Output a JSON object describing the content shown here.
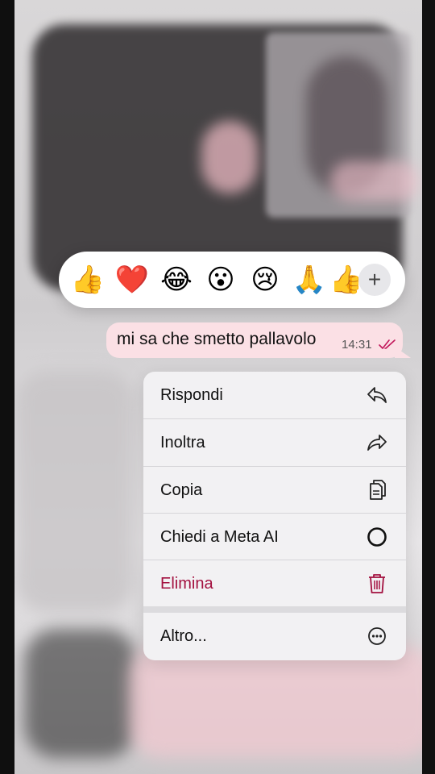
{
  "reactions": {
    "emojis": [
      "👍",
      "❤️",
      "😂",
      "😮",
      "😢",
      "🙏",
      "👍"
    ],
    "more_label": "+"
  },
  "message": {
    "text": "mi sa che smetto pallavolo",
    "time": "14:31",
    "status": "read",
    "bubble_color": "#fbe0e5",
    "tick_color": "#c2185b"
  },
  "menu": {
    "items": [
      {
        "label": "Rispondi",
        "icon": "reply-icon"
      },
      {
        "label": "Inoltra",
        "icon": "forward-icon"
      },
      {
        "label": "Copia",
        "icon": "copy-icon"
      },
      {
        "label": "Chiedi a Meta AI",
        "icon": "meta-ai-icon"
      },
      {
        "label": "Elimina",
        "icon": "trash-icon",
        "danger": true,
        "color": "#a3103f"
      },
      {
        "label": "Altro...",
        "icon": "more-icon"
      }
    ]
  }
}
